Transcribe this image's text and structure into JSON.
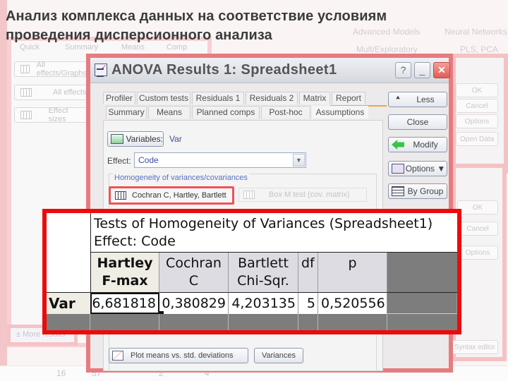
{
  "page_heading": {
    "line1": "Анализ комплекса данных на соответствие условиям",
    "line2": "проведения дисперсионного анализа"
  },
  "background": {
    "left_tabs": [
      "Quick",
      "Summary",
      "Means",
      "Comp"
    ],
    "left_buttons": [
      "All effects/Graphs",
      "All effects",
      "Effect sizes"
    ],
    "more_results": "More results",
    "top_right_items": [
      "Advanced Models",
      "Neural Networks",
      "Mult/Exploratory",
      "PLS, PCA"
    ],
    "right_buttons_1": [
      "OK",
      "Cancel",
      "Options",
      "Open Data"
    ],
    "right_buttons_2": [
      "OK",
      "Cancel",
      "Options"
    ],
    "right_bottom_button": "Syntax editor",
    "bottom_row": [
      "16",
      "57",
      "2",
      "4"
    ]
  },
  "dialog": {
    "title": "ANOVA Results 1: Spreadsheet1",
    "title_buttons": {
      "help": "?",
      "minimize": "_",
      "close": "✕"
    },
    "tabs_row1": [
      "Profiler",
      "Custom tests",
      "Residuals 1",
      "Residuals 2",
      "Matrix",
      "Report"
    ],
    "tabs_row2": [
      "Summary",
      "Means",
      "Planned comps",
      "Post-hoc",
      "Assumptions"
    ],
    "active_tab": "Assumptions",
    "side_buttons": {
      "less": "Less",
      "close": "Close",
      "modify": "Modify",
      "options": "Options ▼",
      "by_group": "By Group"
    },
    "variables_button": "Variables:",
    "variables_value": "Var",
    "effect_label": "Effect:",
    "effect_value": "Code",
    "group_title": "Homogeneity of variances/covariances",
    "cochran_button": "Cochran C, Hartley, Bartlett",
    "boxm_button": "Box M test (cov. matrix)",
    "plot_button": "Plot means vs. std. deviations",
    "variances_button": "Variances"
  },
  "results_table": {
    "title_line1": "Tests of Homogeneity of Variances (Spreadsheet1)",
    "title_line2": "Effect: Code",
    "columns": [
      {
        "line1": "Hartley",
        "line2": "F-max"
      },
      {
        "line1": "Cochran",
        "line2": "C"
      },
      {
        "line1": "Bartlett",
        "line2": "Chi-Sqr."
      },
      {
        "line1": "df",
        "line2": ""
      },
      {
        "line1": "p",
        "line2": ""
      }
    ],
    "rows": [
      {
        "label": "Var",
        "values": [
          "6,681818",
          "0,380829",
          "4,203135",
          "5",
          "0,520556"
        ]
      }
    ]
  },
  "colors": {
    "highlight_red": "#ee0a0a",
    "dialog_border": "#e77b80",
    "accent_blue": "#3b4fa6"
  }
}
